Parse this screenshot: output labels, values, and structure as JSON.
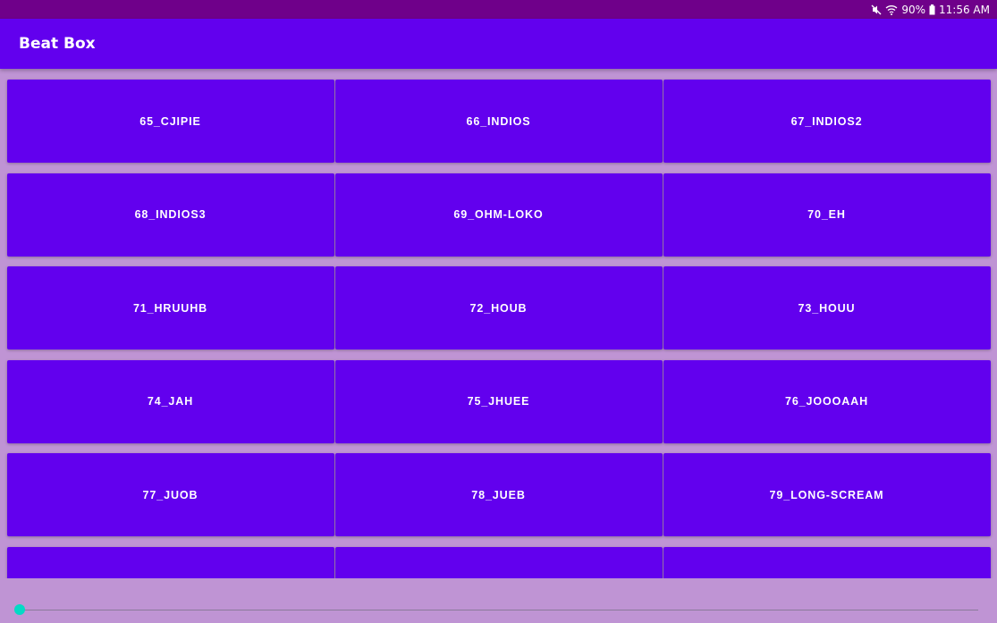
{
  "status_bar": {
    "battery": "90%",
    "time": "11:56 AM",
    "icons": [
      "mute-icon",
      "wifi-icon",
      "battery-icon"
    ]
  },
  "app_bar": {
    "title": "Beat Box"
  },
  "sounds": [
    "65_CJIPIE",
    "66_INDIOS",
    "67_INDIOS2",
    "68_INDIOS3",
    "69_OHM-LOKO",
    "70_EH",
    "71_HRUUHB",
    "72_HOUB",
    "73_HOUU",
    "74_JAH",
    "75_JHUEE",
    "76_JOOOAAH",
    "77_JUOB",
    "78_JUEB",
    "79_LONG-SCREAM",
    "",
    "",
    ""
  ],
  "playback_rate": {
    "value": 0
  },
  "colors": {
    "status_bar": "#6f008a",
    "primary": "#6200ee",
    "background": "#bf94d4",
    "accent": "#03dac5"
  }
}
